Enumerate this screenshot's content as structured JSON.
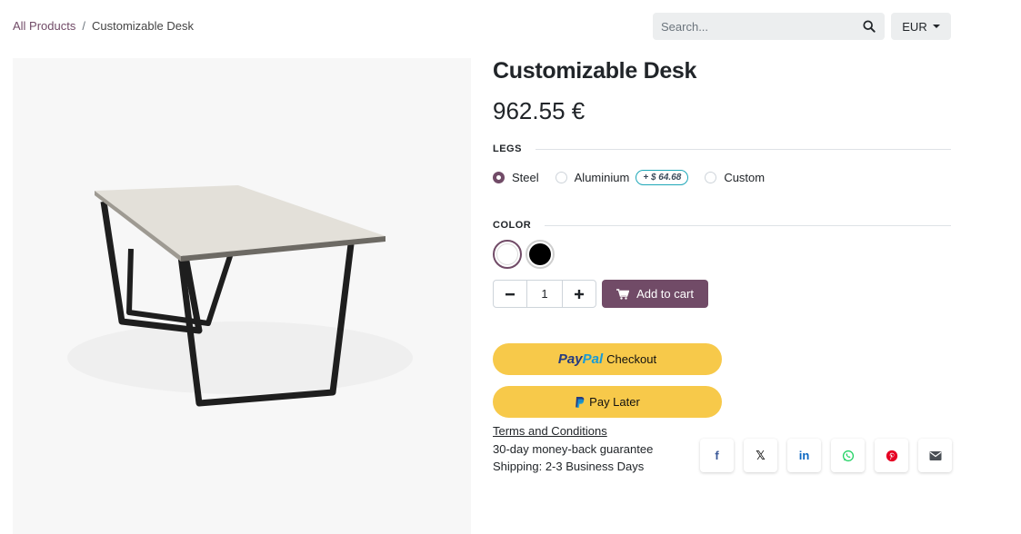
{
  "breadcrumb": {
    "parent": "All Products",
    "separator": "/",
    "current": "Customizable Desk"
  },
  "search": {
    "placeholder": "Search...",
    "icon": "search-icon"
  },
  "currency": {
    "selected": "EUR"
  },
  "product": {
    "title": "Customizable Desk",
    "price": "962.55 €",
    "image": "desk-product-image"
  },
  "legs": {
    "label": "LEGS",
    "options": [
      {
        "label": "Steel",
        "selected": true
      },
      {
        "label": "Aluminium",
        "selected": false,
        "extra": "+ $ 64.68"
      },
      {
        "label": "Custom",
        "selected": false
      }
    ]
  },
  "color": {
    "label": "COLOR",
    "swatches": [
      {
        "value": "#ffffff",
        "selected": true
      },
      {
        "value": "#000000",
        "selected": false
      }
    ]
  },
  "cart": {
    "quantity": "1",
    "add_label": "Add to cart"
  },
  "paypal": {
    "brand_pay": "Pay",
    "brand_pal": "Pal",
    "checkout_label": "Checkout",
    "pay_later_label": "Pay Later",
    "color": "#f7c94a"
  },
  "info": {
    "terms": "Terms and Conditions",
    "guarantee": "30-day money-back guarantee",
    "shipping": "Shipping: 2-3 Business Days"
  },
  "share": {
    "facebook": "f",
    "twitter": "𝕏",
    "linkedin": "in",
    "icons": [
      "facebook-icon",
      "x-twitter-icon",
      "linkedin-icon",
      "whatsapp-icon",
      "pinterest-icon",
      "email-icon"
    ]
  },
  "theme": {
    "primary": "#714b67",
    "badge_border": "#1ea7b8"
  }
}
